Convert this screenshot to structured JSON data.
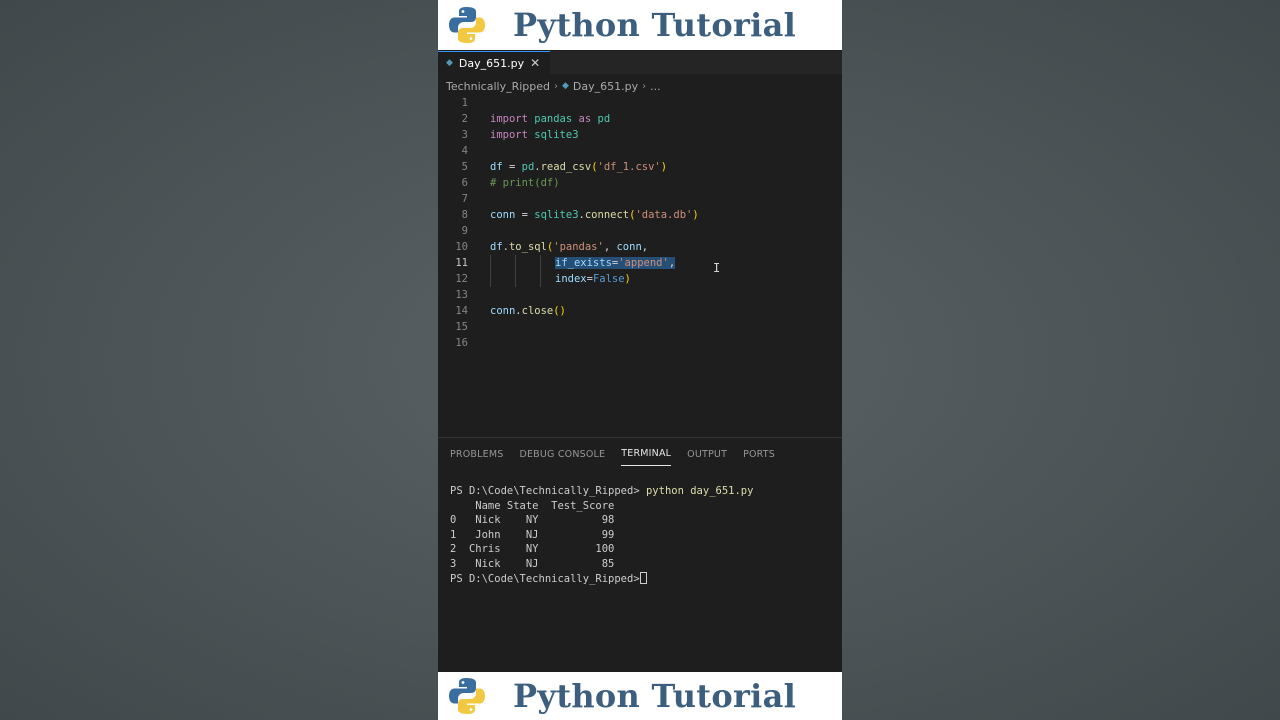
{
  "banner": {
    "title": "Python Tutorial"
  },
  "tab": {
    "label": "Day_651.py",
    "close": "✕"
  },
  "breadcrumb": {
    "folder": "Technically_Ripped",
    "file": "Day_651.py",
    "more": "..."
  },
  "editor": {
    "active_line": 11,
    "line_numbers": [
      "1",
      "2",
      "3",
      "4",
      "5",
      "6",
      "7",
      "8",
      "9",
      "10",
      "11",
      "12",
      "13",
      "14",
      "15",
      "16"
    ],
    "lines": [
      "",
      "import pandas as pd",
      "import sqlite3",
      "",
      "df = pd.read_csv('df_1.csv')",
      "# print(df)",
      "",
      "conn = sqlite3.connect('data.db')",
      "",
      "df.to_sql('pandas', conn,",
      "          if_exists='append',",
      "          index=False)",
      "",
      "conn.close()",
      "",
      ""
    ]
  },
  "panel": {
    "tabs": [
      "PROBLEMS",
      "DEBUG CONSOLE",
      "TERMINAL",
      "OUTPUT",
      "PORTS"
    ],
    "active_tab": "TERMINAL"
  },
  "terminal": {
    "prompt": "PS D:\\Code\\Technically_Ripped>",
    "command": "python day_651.py",
    "header": "    Name State  Test_Score",
    "rows": [
      "0   Nick    NY          98",
      "1   John    NJ          99",
      "2  Chris    NY         100",
      "3   Nick    NJ          85"
    ]
  },
  "colors": {
    "accent": "#3794ff",
    "banner_text": "#3d5f7f",
    "python_blue": "#3a6e9f",
    "python_yellow": "#f3c841"
  },
  "icons": [
    "python-logo-icon",
    "python-file-icon",
    "close-icon",
    "chevron-right-icon",
    "text-cursor-icon"
  ]
}
